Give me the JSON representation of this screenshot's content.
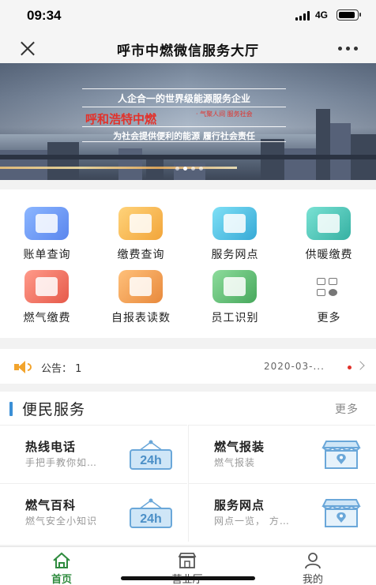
{
  "status": {
    "time": "09:34",
    "network": "4G"
  },
  "header": {
    "title": "呼市中燃微信服务大厅"
  },
  "banner": {
    "headline": "人企合一的世界级能源服务企业",
    "slogan_red": "呼和浩特中燃",
    "slogan_small": "· 气聚人间 服务社会",
    "subline": "为社会提供便利的能源  履行社会责任"
  },
  "grid": {
    "items": [
      {
        "label": "账单查询",
        "color": "#6a9cf3"
      },
      {
        "label": "缴费查询",
        "color": "#f5b54a"
      },
      {
        "label": "服务网点",
        "color": "#4dbfe0"
      },
      {
        "label": "供暖缴费",
        "color": "#4cc6b9"
      },
      {
        "label": "燃气缴费",
        "color": "#ef6f5f"
      },
      {
        "label": "自报表读数",
        "color": "#f0a85b"
      },
      {
        "label": "员工识别",
        "color": "#5fbe76"
      },
      {
        "label": "更多",
        "color": "#888888"
      }
    ]
  },
  "notice": {
    "label": "公告： 1",
    "date": "2020-03-..."
  },
  "services": {
    "title": "便民服务",
    "more": "更多",
    "items": [
      {
        "name": "热线电话",
        "desc": "手把手教你如…",
        "icon": "24h-sign-icon"
      },
      {
        "name": "燃气报装",
        "desc": "燃气报装",
        "icon": "shop-location-icon"
      },
      {
        "name": "燃气百科",
        "desc": "燃气安全小知识",
        "icon": "24h-sign-icon"
      },
      {
        "name": "服务网点",
        "desc": "网点一览， 方…",
        "icon": "shop-location-icon"
      }
    ]
  },
  "tabs": [
    {
      "label": "首页",
      "active": true
    },
    {
      "label": "营业厅",
      "active": false
    },
    {
      "label": "我的",
      "active": false
    }
  ],
  "colors": {
    "accent_green": "#2e8b3e",
    "section_bar": "#3a8fd6",
    "notice_orange": "#f2a42c"
  }
}
